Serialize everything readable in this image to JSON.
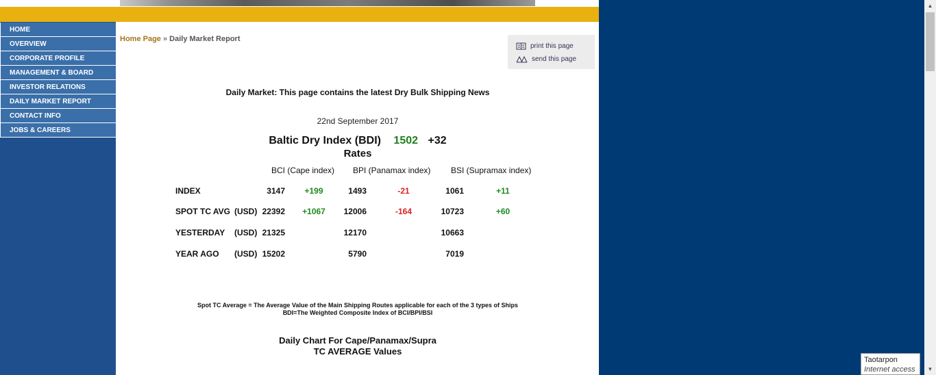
{
  "nav": {
    "items": [
      "HOME",
      "OVERVIEW",
      "CORPORATE PROFILE",
      "MANAGEMENT & BOARD",
      "INVESTOR RELATIONS",
      "DAILY MARKET REPORT",
      "CONTACT INFO",
      "JOBS & CAREERS"
    ]
  },
  "breadcrumb": {
    "home": "Home Page",
    "separator": "»",
    "current": "Daily Market Report"
  },
  "tools": {
    "print": "print this page",
    "send": "send this page"
  },
  "intro": "Daily Market: This page contains the latest Dry Bulk Shipping News",
  "date": "22nd September 2017",
  "bdi": {
    "label": "Baltic Dry Index (BDI)",
    "value": "1502",
    "change": "+32"
  },
  "rates_title": "Rates",
  "columns": {
    "bci": "BCI  (Cape index)",
    "bpi": "BPI  (Panamax index)",
    "bsi": "BSI  (Supramax index)"
  },
  "rows": {
    "index": {
      "label": "INDEX",
      "bci": "3147",
      "bci_chg": "+199",
      "bpi": "1493",
      "bpi_chg": "-21",
      "bsi": "1061",
      "bsi_chg": "+11"
    },
    "spot": {
      "label": "SPOT TC AVG",
      "unit": "(USD)",
      "bci": "22392",
      "bci_chg": "+1067",
      "bpi": "12006",
      "bpi_chg": "-164",
      "bsi": "10723",
      "bsi_chg": "+60"
    },
    "yesterday": {
      "label": "YESTERDAY",
      "unit": "(USD)",
      "bci": "21325",
      "bpi": "12170",
      "bsi": "10663"
    },
    "year_ago": {
      "label": "YEAR AGO",
      "unit": "(USD)",
      "bci": "15202",
      "bpi": "5790",
      "bsi": "7019"
    }
  },
  "footnote": {
    "line1": "Spot  TC Average = The Average Value of the Main Shipping Routes applicable for each of the 3 types of Ships",
    "line2": "BDI=The Weighted Composite Index of BCI/BPI/BSI"
  },
  "chart_title": {
    "line1": "Daily Chart For Cape/Panamax/Supra",
    "line2": "TC AVERAGE Values"
  },
  "network_popup": {
    "name": "Taotarpon",
    "status": "Internet access"
  },
  "colors": {
    "background": "#003a75",
    "gold_bar": "#e8b10f",
    "nav": "#3a6fa9",
    "positive": "#1e8a1e",
    "negative": "#e02020",
    "bdi_value": "#1e7f1e"
  }
}
